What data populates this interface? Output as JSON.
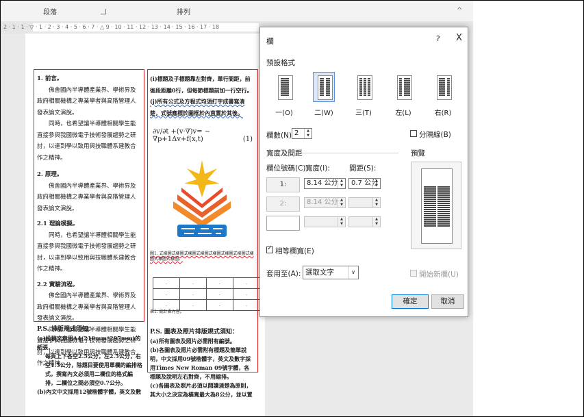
{
  "ribbon": {
    "group_paragraph": "段落",
    "group_arrange": "排列",
    "collapse_glyph": "^"
  },
  "ruler": {
    "text": "2 · 1 · 1 · ▽ · 1 · 2 · 3 · 4 · 5 · 6 · 7 · △ 9 · 10 · 11 · 12 · 13 · 14 · 15 · 16 · 17 · 18"
  },
  "document": {
    "left_column": [
      {
        "type": "heading",
        "text": "1. 前言。"
      },
      {
        "type": "para",
        "text": "佛舍國內半導體產業界、學術界及政府相關機構之專業學者與高階管理人發表論文演說。"
      },
      {
        "type": "para",
        "text": "同時，也希望讓半導體相關學生能直接參與我國微電子技術發展趨勢之研討，以達到學以致用與技職體系建教合作之精神。"
      },
      {
        "type": "heading",
        "text": "2. 原理。"
      },
      {
        "type": "para",
        "text": "佛舍國內半導體產業界、學術界及政府相關機構之專業學者與高階管理人發表論文演說。"
      },
      {
        "type": "heading",
        "text": "2.1 理論模擬。"
      },
      {
        "type": "para",
        "text": "同時，也希望讓半導體相關學生能直接參與我國微電子技術發展趨勢之研討，以達到學以致用與技職體系建教合作之精神。"
      },
      {
        "type": "heading",
        "text": "2.2 實驗流程。"
      },
      {
        "type": "para",
        "text": "佛舍國內半導體產業界、學術界及政府相關機構之專業學者與高階管理人發表論文演說。"
      },
      {
        "type": "para",
        "text": "同時，也希望讓半導體相關學生能直接參與我國微電子技術發展趨勢之研討，以達到學以致用與技職體系建教合作之精神。"
      }
    ],
    "right_column": {
      "line1": "(i)標題及子標題靠左對齊，單行間距，前後段距離0行，但每節標題前加一行空行。",
      "line2": "(j)所有公式及方程式均須打字成書寫清楚，式號應標於圖框於內直置於其後。",
      "equation": "∂v/∂t +(v·∇)v= − ∇p+1Δv+f(x,t)",
      "eq_number": "(1)",
      "figure_caption": "圖1. 式樣圖式樣圖式樣圖式樣圖式樣圖式樣圖式樣圖式樣圖式樣圖式樣圖。",
      "table_caption": "表1. 統計表內容。",
      "ps_heading": "P.S. 圖表及照片排版規式須知：",
      "ps_lines": [
        "(a)所有圖表及照片必需附有編號。",
        "(b)各圖表及照片必需附有標題及簡單說明，中文採用09號楷體字，英文及數字採用Times New Roman 09號字體，各標題及說明左右對齊，不用縮排。",
        "(c)各圖表及照片必須以閱讀清楚為原則，其大小之決定為橫寬最大為8公分，並以置"
      ]
    },
    "bottom_left": {
      "ps_heading": "P.S. 排版規式須知：",
      "lines": [
        "(a)投稿文章用A4(210mm*297mm)的紙張，",
        "每頁上下各空2.5公分，左2.5公分，右空1.5公分，除題目要使用單欄的編排格式，撰寫內文必須用二欄位的格式編排，二欄位之間必須空0.7公分。",
        "(b)內文中文採用12號楷體字體，英文及數"
      ]
    }
  },
  "dialog": {
    "title": "欄",
    "help": "?",
    "close": "X",
    "presets_label": "預設格式",
    "presets": [
      "一(O)",
      "二(W)",
      "三(T)",
      "左(L)",
      "右(R)"
    ],
    "num_cols_label": "欄數(N):",
    "num_cols_value": "2",
    "line_between_label": "分隔線(B)",
    "width_spacing_label": "寬度及間距",
    "preview_label": "預覽",
    "col_num_header": "欄位號碼(C):",
    "width_header": "寬度(I):",
    "spacing_header": "間距(S):",
    "rows": [
      {
        "num": "1:",
        "width": "8.14 公分",
        "spacing": "0.7 公分"
      },
      {
        "num": "2:",
        "width": "8.14 公分",
        "spacing": ""
      },
      {
        "num": "",
        "width": "",
        "spacing": ""
      }
    ],
    "equal_width_label": "相等欄寬(E)",
    "apply_to_label": "套用至(A):",
    "apply_to_value": "選取文字",
    "new_column_label": "開始新欄(U)",
    "ok": "確定",
    "cancel": "取消"
  }
}
